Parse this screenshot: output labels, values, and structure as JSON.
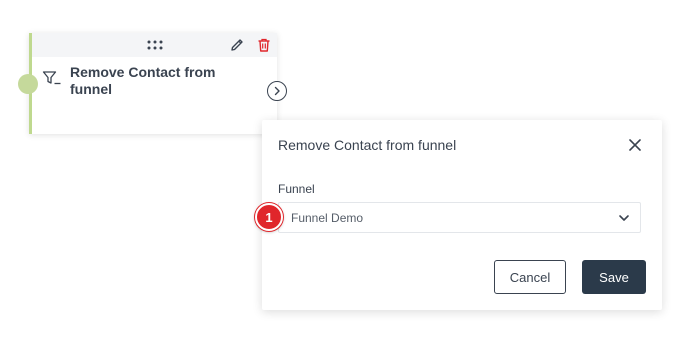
{
  "node": {
    "title": "Remove Contact from funnel",
    "accent_color": "#bfd98f",
    "icons": {
      "drag": "drag-handle-icon",
      "edit": "pencil-icon",
      "delete": "trash-icon",
      "type": "filter-icon",
      "next": "chevron-right-icon"
    }
  },
  "popup": {
    "title": "Remove Contact from funnel",
    "field_label": "Funnel",
    "selected_value": "Funnel Demo",
    "cancel_label": "Cancel",
    "save_label": "Save",
    "save_color": "#2b3a4a"
  },
  "step_marker": {
    "number": "1",
    "color": "#e0262b"
  }
}
